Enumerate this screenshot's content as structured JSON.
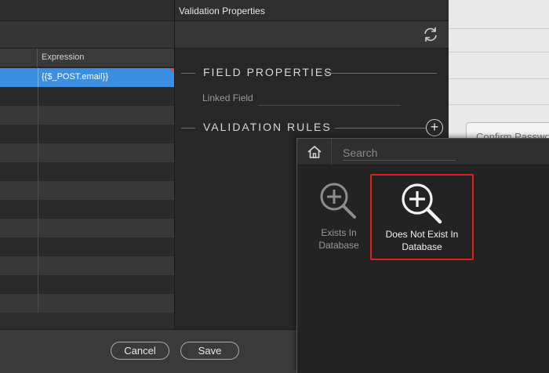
{
  "background": {
    "partial_button_label": "Confirm Password"
  },
  "grid": {
    "column_header": "Expression",
    "selected_expression": "{{$_POST.email}}",
    "row_count": 13
  },
  "validation_panel": {
    "title": "Validation Properties",
    "field_properties_heading": "FIELD PROPERTIES",
    "linked_field_label": "Linked Field",
    "linked_field_value": "",
    "validation_rules_heading": "VALIDATION RULES"
  },
  "footer": {
    "cancel_label": "Cancel",
    "save_label": "Save"
  },
  "popup": {
    "search_placeholder": "Search",
    "items": [
      {
        "label_line1": "Exists In",
        "label_line2": "Database",
        "icon": "search-plus-icon",
        "highlighted": false
      },
      {
        "label_line1": "Does Not Exist In",
        "label_line2": "Database",
        "icon": "search-plus-icon",
        "highlighted": true
      }
    ]
  },
  "colors": {
    "selection": "#3b8fe3",
    "highlight_border": "#e01e1e",
    "panel_bg": "#272727"
  }
}
